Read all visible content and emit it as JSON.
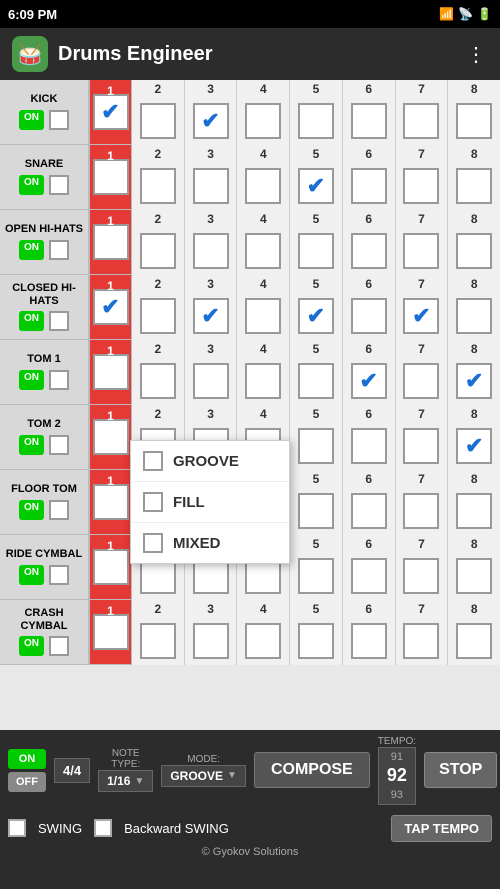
{
  "status": {
    "time": "6:09 PM",
    "battery": "100"
  },
  "app": {
    "title": "Drums Engineer",
    "icon": "🥁"
  },
  "rows": [
    {
      "name": "KICK",
      "onLabel": "ON",
      "beats": [
        true,
        false,
        true,
        false,
        false,
        false,
        false,
        false
      ],
      "col1Checked": true
    },
    {
      "name": "SNARE",
      "onLabel": "ON",
      "beats": [
        false,
        false,
        false,
        false,
        true,
        false,
        false,
        false
      ],
      "col1Checked": false
    },
    {
      "name": "OPEN HI-HATS",
      "onLabel": "ON",
      "beats": [
        true,
        false,
        false,
        false,
        false,
        false,
        false,
        false
      ],
      "col1Checked": false
    },
    {
      "name": "CLOSED HI-HATS",
      "onLabel": "ON",
      "beats": [
        true,
        false,
        true,
        false,
        true,
        false,
        true,
        false
      ],
      "col1Checked": true
    },
    {
      "name": "TOM 1",
      "onLabel": "ON",
      "beats": [
        false,
        false,
        false,
        false,
        false,
        true,
        false,
        true
      ],
      "col1Checked": false
    },
    {
      "name": "TOM 2",
      "onLabel": "ON",
      "beats": [
        false,
        false,
        false,
        false,
        false,
        false,
        false,
        true
      ],
      "col1Checked": false
    },
    {
      "name": "FLOOR TOM",
      "onLabel": "ON",
      "beats": [
        false,
        false,
        false,
        false,
        false,
        false,
        false,
        false
      ],
      "col1Checked": false
    },
    {
      "name": "RIDE CYMBAL",
      "onLabel": "ON",
      "beats": [
        false,
        false,
        false,
        false,
        false,
        false,
        false,
        false
      ],
      "col1Checked": false
    },
    {
      "name": "CRASH CYMBAL",
      "onLabel": "ON",
      "beats": [
        false,
        false,
        false,
        false,
        false,
        false,
        false,
        false
      ],
      "col1Checked": false
    }
  ],
  "beatNumbers": [
    "1",
    "2",
    "3",
    "4",
    "5",
    "6",
    "7",
    "8"
  ],
  "dropdown": {
    "items": [
      "GROOVE",
      "FILL",
      "MIXED"
    ]
  },
  "controls": {
    "timeSig": "4/4",
    "noteTypeLabel": "NOTE TYPE:",
    "noteTypeValue": "1/16",
    "modeLabel": "MODE:",
    "modeValue": "GROOVE",
    "composeLabel": "COMPOSE",
    "tempoLabel": "TEMPO:",
    "tempoAbove": "91",
    "tempoCurrent": "92",
    "tempoBelow": "93",
    "stopLabel": "STOP",
    "swingLabel": "SWING",
    "backwardSwingLabel": "Backward SWING",
    "tapTempoLabel": "TAP TEMPO",
    "copyright": "© Gyokov Solutions",
    "onLabel": "ON",
    "offLabel": "OFF"
  }
}
